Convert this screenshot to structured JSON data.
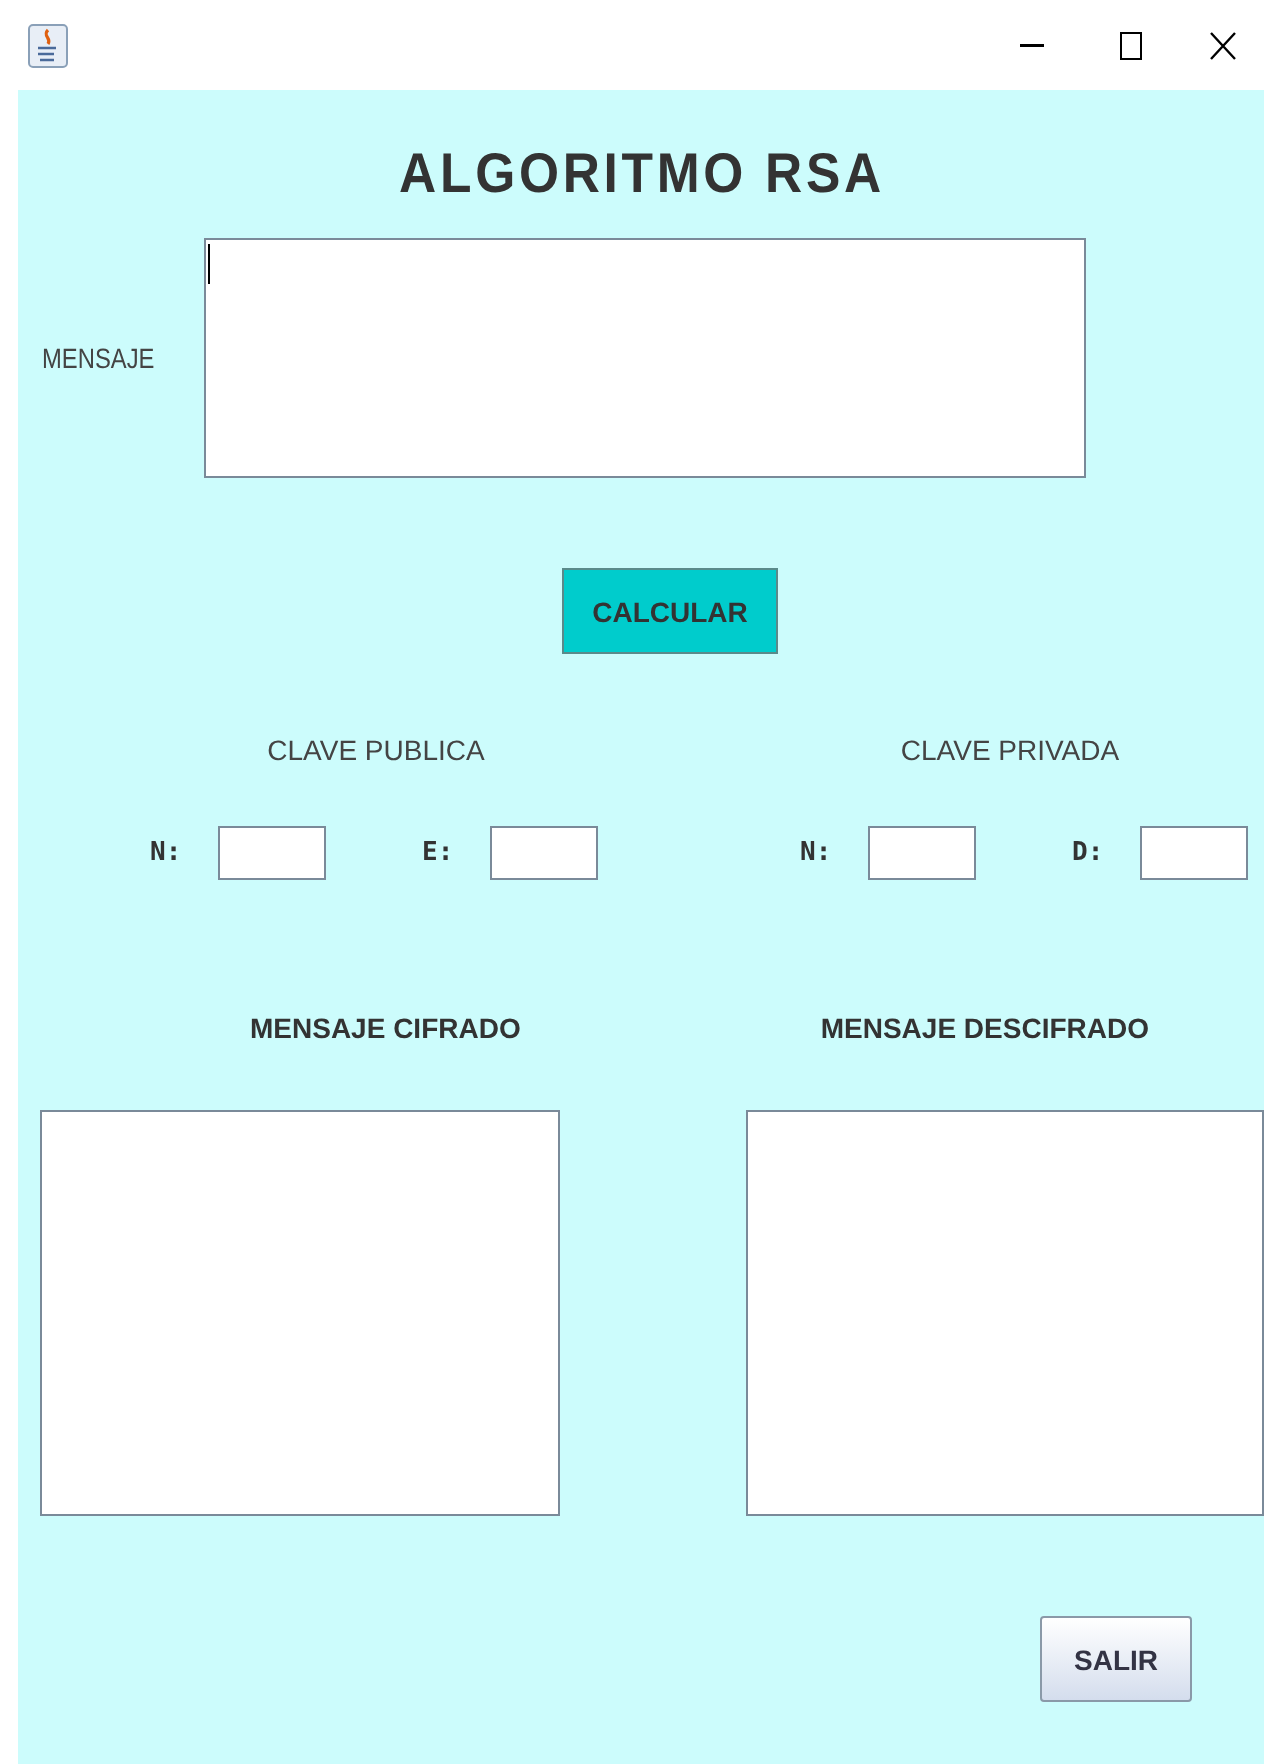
{
  "title": "ALGORITMO RSA",
  "message": {
    "label": "MENSAJE",
    "focused": true
  },
  "calculate_button": "CALCULAR",
  "keys": [
    {
      "heading": "CLAVE PUBLICA",
      "fields": [
        {
          "label": "N:"
        },
        {
          "label": "E:"
        }
      ]
    },
    {
      "heading": "CLAVE PRIVADA",
      "fields": [
        {
          "label": "N:"
        },
        {
          "label": "D:"
        }
      ]
    }
  ],
  "outputs": [
    {
      "heading": "MENSAJE CIFRADO"
    },
    {
      "heading": "MENSAJE DESCIFRADO"
    }
  ],
  "exit_button": "SALIR"
}
